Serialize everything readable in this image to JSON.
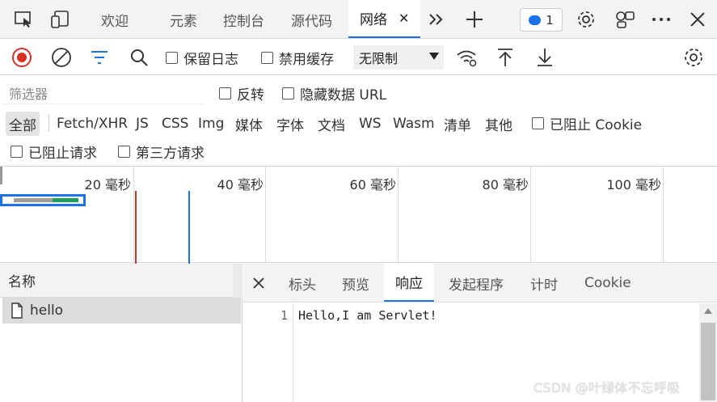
{
  "tabs": [
    {
      "label": "欢迎"
    },
    {
      "label": "元素"
    },
    {
      "label": "控制台"
    },
    {
      "label": "源代码"
    },
    {
      "label": "网络",
      "active": true
    }
  ],
  "tab_close": "✕",
  "issues_count": "1",
  "toolbar": {
    "preserve_log": "保留日志",
    "disable_cache": "禁用缓存",
    "throttle": "无限制"
  },
  "filter": {
    "placeholder": "筛选器",
    "invert": "反转",
    "hide_data_urls": "隐藏数据 URL",
    "types": [
      "全部",
      "Fetch/XHR",
      "JS",
      "CSS",
      "Img",
      "媒体",
      "字体",
      "文档",
      "WS",
      "Wasm",
      "清单",
      "其他"
    ],
    "blocked_cookies": "已阻止 Cookie",
    "blocked_requests": "已阻止请求",
    "third_party": "第三方请求"
  },
  "overview": {
    "ticks": [
      "20 毫秒",
      "40 毫秒",
      "60 毫秒",
      "80 毫秒",
      "100 毫秒"
    ]
  },
  "requests": {
    "header": "名称",
    "items": [
      {
        "name": "hello"
      }
    ]
  },
  "detail_tabs": [
    "标头",
    "预览",
    "响应",
    "发起程序",
    "计时",
    "Cookie"
  ],
  "detail_active": "响应",
  "response": {
    "lines": [
      {
        "num": "1",
        "text": "Hello,I am Servlet!"
      }
    ]
  },
  "watermark": "CSDN @叶绿体不忘呼吸",
  "colors": {
    "accent": "#1a73e8",
    "record": "#d93025"
  }
}
